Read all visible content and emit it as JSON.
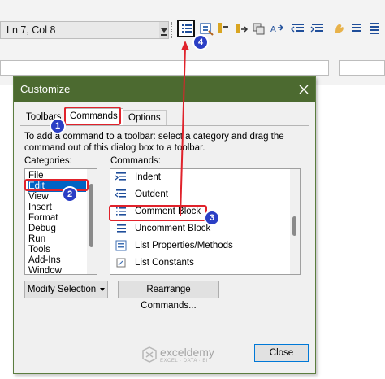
{
  "editor": {
    "status": "Ln 7, Col 8"
  },
  "toolbar_icons": [
    "comment-block-icon",
    "procedure-icon",
    "toggle-bookmark-icon",
    "next-bookmark-icon",
    "previous-bookmark-icon",
    "clear-bookmarks-icon",
    "outdent-icon",
    "indent-icon",
    "breakpoint-icon",
    "uncomment-block-icon",
    "list-icon"
  ],
  "dialog": {
    "title": "Customize",
    "tabs": [
      {
        "label": "Toolbars"
      },
      {
        "label": "Commands"
      },
      {
        "label": "Options"
      }
    ],
    "instructions": "To add a command to a toolbar: select a category and drag the command out of this dialog box to a toolbar.",
    "categories_label": "Categories:",
    "commands_label": "Commands:",
    "categories": [
      "File",
      "Edit",
      "View",
      "Insert",
      "Format",
      "Debug",
      "Run",
      "Tools",
      "Add-Ins",
      "Window"
    ],
    "selected_category": "Edit",
    "commands": [
      "Indent",
      "Outdent",
      "Comment Block",
      "Uncomment Block",
      "List Properties/Methods",
      "List Constants"
    ],
    "modify_selection": "Modify Selection",
    "rearrange": "Rearrange Commands...",
    "close": "Close"
  },
  "watermark": {
    "name": "exceldemy",
    "tagline": "EXCEL · DATA · BI"
  },
  "callouts": [
    "1",
    "2",
    "3",
    "4"
  ],
  "colors": {
    "titlebar": "#4c6a30",
    "selection": "#0063c4",
    "annotation_red": "#e0222b",
    "badge_blue": "#2b3fc5"
  }
}
